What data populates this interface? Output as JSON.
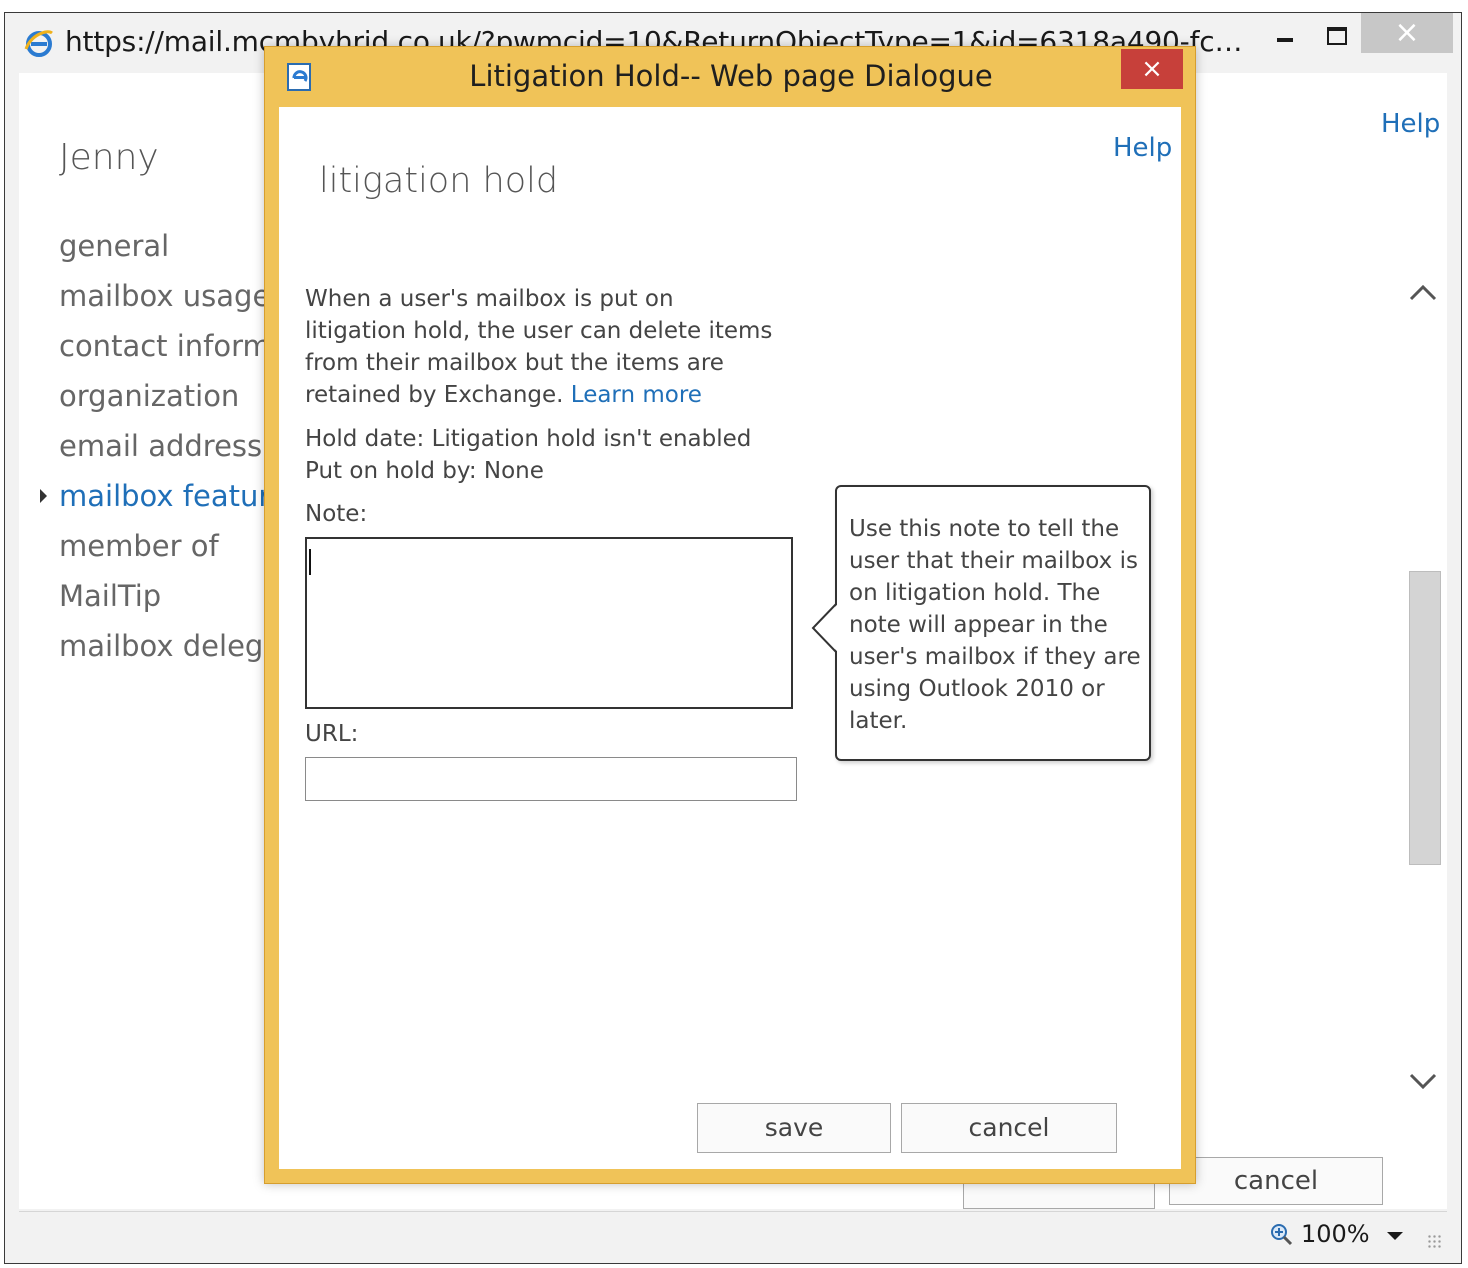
{
  "browser": {
    "url": "https://mail.mcmbyhrid.co.uk/?pwmcid=10&ReturnObjectType=1&id=6318a490-fcb1-4...",
    "icon": "ie-icon",
    "controls": {
      "close_label": "×"
    }
  },
  "background_page": {
    "help_label": "Help",
    "user_name": "Jenny",
    "nav_items": [
      {
        "label": "general"
      },
      {
        "label": "mailbox usage"
      },
      {
        "label": "contact informat"
      },
      {
        "label": "organization"
      },
      {
        "label": "email address"
      },
      {
        "label": "mailbox feature",
        "active": true
      },
      {
        "label": "member of"
      },
      {
        "label": "MailTip"
      },
      {
        "label": "mailbox delegati"
      }
    ],
    "cancel_label": "cancel"
  },
  "statusbar": {
    "zoom": "100%"
  },
  "dialog": {
    "title": "Litigation Hold-- Web page Dialogue",
    "close_label": "×",
    "help_label": "Help",
    "heading": "litigation hold",
    "description": "When a user's mailbox is put on litigation hold, the user can delete items from their mailbox but the items are retained by Exchange.",
    "learn_more_label": "Learn more",
    "hold_date": "Hold date: Litigation hold isn't enabled",
    "put_on_hold_by": "Put on hold by: None",
    "note_label": "Note:",
    "note_value": "",
    "url_label": "URL:",
    "url_value": "",
    "callout_text": "Use this note to tell the user that their mailbox is on litigation hold. The note will appear in the user's mailbox if they are using Outlook 2010 or later.",
    "save_label": "save",
    "cancel_label": "cancel"
  },
  "colors": {
    "dialog_frame": "#f0c358",
    "dialog_close": "#c7403a",
    "link": "#1f6fb8"
  }
}
